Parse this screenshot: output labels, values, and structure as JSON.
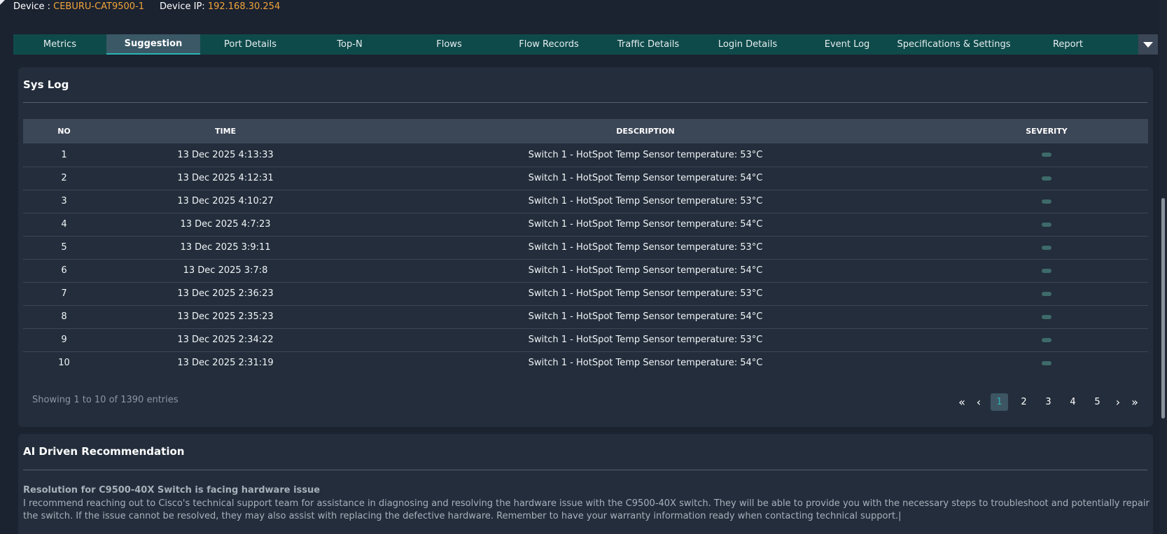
{
  "device": {
    "device_label": "Device :",
    "device_name": "CEBURU-CAT9500-1",
    "ip_label": "Device IP:",
    "ip_value": "192.168.30.254"
  },
  "tabs": [
    {
      "label": "Metrics"
    },
    {
      "label": "Suggestion"
    },
    {
      "label": "Port Details"
    },
    {
      "label": "Top-N"
    },
    {
      "label": "Flows"
    },
    {
      "label": "Flow Records"
    },
    {
      "label": "Traffic Details"
    },
    {
      "label": "Login Details"
    },
    {
      "label": "Event Log"
    },
    {
      "label": "Specifications & Settings"
    },
    {
      "label": "Report"
    }
  ],
  "active_tab": "Suggestion",
  "syslog": {
    "title": "Sys Log",
    "columns": {
      "no": "NO",
      "time": "TIME",
      "description": "DESCRIPTION",
      "severity": "SEVERITY"
    },
    "rows": [
      {
        "no": "1",
        "time": "13 Dec 2025 4:13:33",
        "description": "Switch 1 - HotSpot Temp Sensor temperature: 53°C"
      },
      {
        "no": "2",
        "time": "13 Dec 2025 4:12:31",
        "description": "Switch 1 - HotSpot Temp Sensor temperature: 54°C"
      },
      {
        "no": "3",
        "time": "13 Dec 2025 4:10:27",
        "description": "Switch 1 - HotSpot Temp Sensor temperature: 53°C"
      },
      {
        "no": "4",
        "time": "13 Dec 2025 4:7:23",
        "description": "Switch 1 - HotSpot Temp Sensor temperature: 54°C"
      },
      {
        "no": "5",
        "time": "13 Dec 2025 3:9:11",
        "description": "Switch 1 - HotSpot Temp Sensor temperature: 53°C"
      },
      {
        "no": "6",
        "time": "13 Dec 2025 3:7:8",
        "description": "Switch 1 - HotSpot Temp Sensor temperature: 54°C"
      },
      {
        "no": "7",
        "time": "13 Dec 2025 2:36:23",
        "description": "Switch 1 - HotSpot Temp Sensor temperature: 53°C"
      },
      {
        "no": "8",
        "time": "13 Dec 2025 2:35:23",
        "description": "Switch 1 - HotSpot Temp Sensor temperature: 54°C"
      },
      {
        "no": "9",
        "time": "13 Dec 2025 2:34:22",
        "description": "Switch 1 - HotSpot Temp Sensor temperature: 53°C"
      },
      {
        "no": "10",
        "time": "13 Dec 2025 2:31:19",
        "description": "Switch 1 - HotSpot Temp Sensor temperature: 54°C"
      }
    ],
    "entries_info": "Showing 1 to 10 of 1390 entries",
    "pagination": {
      "first": "«",
      "prev": "‹",
      "pages": [
        "1",
        "2",
        "3",
        "4",
        "5"
      ],
      "current": "1",
      "next": "›",
      "last": "»"
    }
  },
  "ai": {
    "title": "AI Driven Recommendation",
    "resolution_title": "Resolution for C9500-40X Switch is facing hardware issue",
    "resolution_text": "I recommend reaching out to Cisco's technical support team for assistance in diagnosing and resolving the hardware issue with the C9500-40X switch. They will be able to provide you with the necessary steps to troubleshoot and potentially repair the switch. If the issue cannot be resolved, they may also assist with replacing the defective hardware. Remember to have your warranty information ready when contacting technical support.|"
  },
  "colors": {
    "accent": "#2bb3b1",
    "device_value": "#f0a43a",
    "tab_bar": "#0f4a4a",
    "severity_pill": "#3e6a6a"
  }
}
